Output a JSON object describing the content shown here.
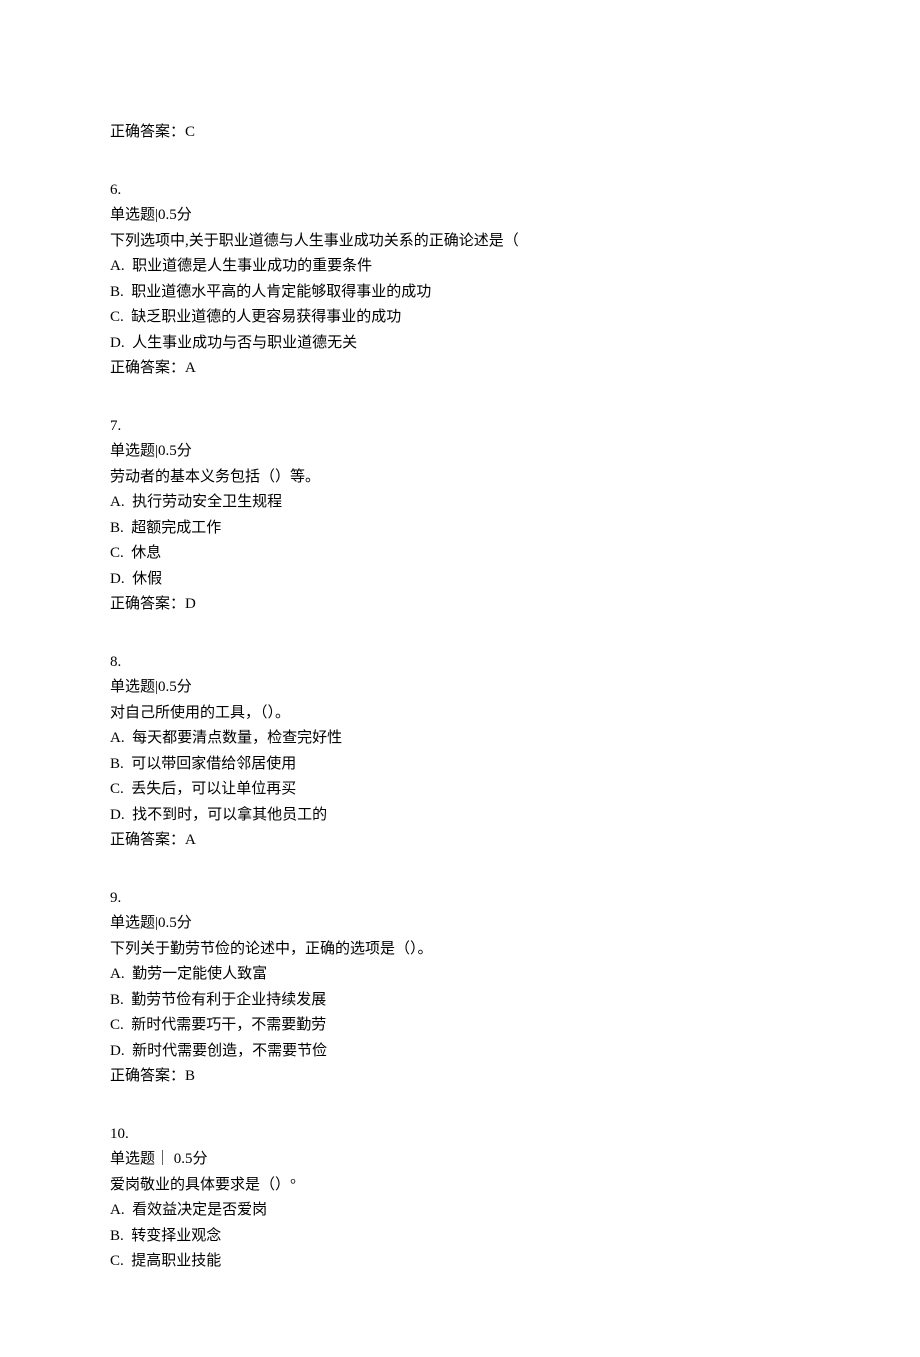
{
  "prev_answer": "正确答案：C",
  "questions": [
    {
      "num": "6.",
      "meta": "单选题|0.5分",
      "stem": "下列选项中,关于职业道德与人生事业成功关系的正确论述是（",
      "options": [
        {
          "letter": "A.",
          "text": "职业道德是人生事业成功的重要条件"
        },
        {
          "letter": "B.",
          "text": "职业道德水平高的人肯定能够取得事业的成功"
        },
        {
          "letter": "C.",
          "text": "缺乏职业道德的人更容易获得事业的成功"
        },
        {
          "letter": "D.",
          "text": "人生事业成功与否与职业道德无关"
        }
      ],
      "correct": "正确答案：A"
    },
    {
      "num": "7.",
      "meta": "单选题|0.5分",
      "stem": "劳动者的基本义务包括（）等。",
      "options": [
        {
          "letter": "A.",
          "text": "执行劳动安全卫生规程"
        },
        {
          "letter": "B.",
          "text": "超额完成工作"
        },
        {
          "letter": "C.",
          "text": "休息"
        },
        {
          "letter": "D.",
          "text": "休假"
        }
      ],
      "correct": "正确答案：D"
    },
    {
      "num": "8.",
      "meta": "单选题|0.5分",
      "stem": "对自己所使用的工具，（）。",
      "options": [
        {
          "letter": "A.",
          "text": "每天都要清点数量，检查完好性"
        },
        {
          "letter": "B.",
          "text": "可以带回家借给邻居使用"
        },
        {
          "letter": "C.",
          "text": "丢失后，可以让单位再买"
        },
        {
          "letter": "D.",
          "text": "找不到时，可以拿其他员工的"
        }
      ],
      "correct": "正确答案：A"
    },
    {
      "num": "9.",
      "meta": "单选题|0.5分",
      "stem": "下列关于勤劳节俭的论述中，正确的选项是（）。",
      "options": [
        {
          "letter": "A.",
          "text": "勤劳一定能使人致富"
        },
        {
          "letter": "B.",
          "text": "勤劳节俭有利于企业持续发展"
        },
        {
          "letter": "C.",
          "text": "新时代需要巧干，不需要勤劳"
        },
        {
          "letter": "D.",
          "text": "新时代需要创造，不需要节俭"
        }
      ],
      "correct": "正确答案：B"
    },
    {
      "num": "10.",
      "meta": "单选题｜ 0.5分",
      "stem": "爱岗敬业的具体要求是（）°",
      "options": [
        {
          "letter": "A.",
          "text": "看效益决定是否爱岗"
        },
        {
          "letter": "B.",
          "text": "转变择业观念"
        },
        {
          "letter": "C.",
          "text": "提高职业技能"
        }
      ],
      "correct": null
    }
  ]
}
